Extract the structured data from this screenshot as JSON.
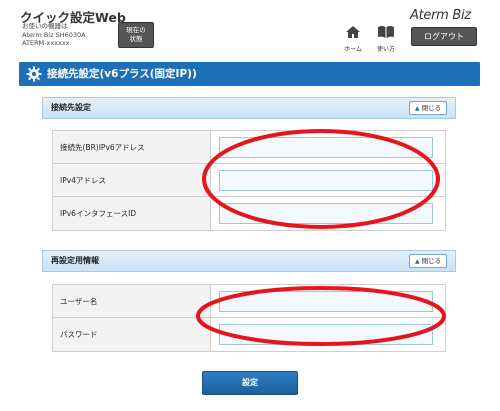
{
  "header": {
    "app_title": "クイック設定Web",
    "device_info": [
      "お使いの機器は",
      "Aterm Biz SH6030A",
      "ATERM-xxxxxx"
    ],
    "status_button": [
      "現在の",
      "状態"
    ],
    "brand": "Aterm Biz",
    "nav": {
      "home_label": "ホーム",
      "manual_label": "使い方"
    },
    "logout_label": "ログアウト"
  },
  "page": {
    "title": "接続先設定(v6プラス(固定IP))"
  },
  "sections": [
    {
      "title": "接続先設定",
      "close_label": "閉じる",
      "fields": [
        {
          "label": "接続先(BR)IPv6アドレス",
          "value": ""
        },
        {
          "label": "IPv4アドレス",
          "value": ""
        },
        {
          "label": "IPv6インタフェースID",
          "value": ""
        }
      ]
    },
    {
      "title": "再設定用情報",
      "close_label": "閉じる",
      "fields": [
        {
          "label": "ユーザー名",
          "value": ""
        },
        {
          "label": "パスワード",
          "value": ""
        }
      ]
    }
  ],
  "submit_label": "設定",
  "colors": {
    "accent": "#1d6fb8",
    "highlight_ring": "#e8141b",
    "input_border": "#9fc5e3"
  },
  "icons": {
    "title_icon": "gear-icon",
    "home": "home-icon",
    "manual": "book-icon",
    "close_chevron": "chevron-up-icon"
  }
}
